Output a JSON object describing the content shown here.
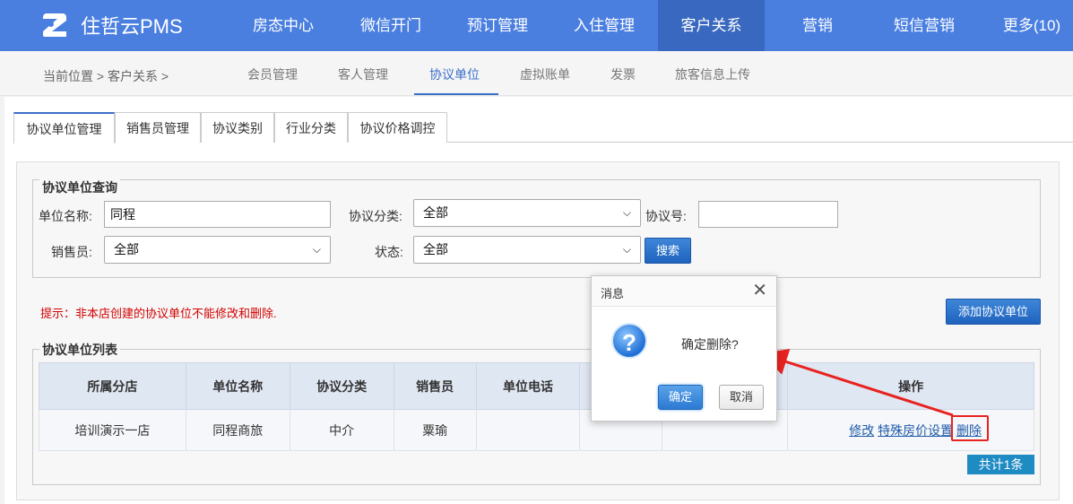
{
  "app": {
    "name": "住哲云PMS"
  },
  "nav": {
    "items": [
      {
        "label": "房态中心"
      },
      {
        "label": "微信开门"
      },
      {
        "label": "预订管理"
      },
      {
        "label": "入住管理"
      },
      {
        "label": "客户关系"
      },
      {
        "label": "营销"
      },
      {
        "label": "短信营销"
      },
      {
        "label": "更多(10)"
      }
    ]
  },
  "breadcrumb": "当前位置 > 客户关系 >",
  "subtabs": [
    {
      "label": "会员管理"
    },
    {
      "label": "客人管理"
    },
    {
      "label": "协议单位"
    },
    {
      "label": "虚拟账单"
    },
    {
      "label": "发票"
    },
    {
      "label": "旅客信息上传"
    }
  ],
  "tabs": [
    {
      "label": "协议单位管理"
    },
    {
      "label": "销售员管理"
    },
    {
      "label": "协议类别"
    },
    {
      "label": "行业分类"
    },
    {
      "label": "协议价格调控"
    }
  ],
  "query": {
    "legend": "协议单位查询",
    "name_label": "单位名称:",
    "name_value": "同程",
    "category_label": "协议分类:",
    "category_value": "全部",
    "code_label": "协议号:",
    "code_value": "",
    "sales_label": "销售员:",
    "sales_value": "全部",
    "status_label": "状态:",
    "status_value": "全部",
    "search_label": "搜索"
  },
  "tip": "提示：非本店创建的协议单位不能修改和删除.",
  "add_button": "添加协议单位",
  "list": {
    "legend": "协议单位列表",
    "headers": [
      "所属分店",
      "单位名称",
      "协议分类",
      "销售员",
      "单位电话",
      "",
      "",
      "操作"
    ],
    "rows": [
      {
        "branch": "培训演示一店",
        "name": "同程商旅",
        "category": "中介",
        "sales": "粟瑜",
        "phone": "",
        "c6": "",
        "c7": ""
      }
    ],
    "actions": {
      "edit": "修改",
      "special": "特殊房价设置",
      "delete": "删除"
    },
    "total": "共计1条"
  },
  "dialog": {
    "title": "消息",
    "message": "确定删除?",
    "ok": "确定",
    "cancel": "取消"
  },
  "colors": {
    "nav": "#4a7fe0",
    "accent": "#3a6fc9",
    "highlight": "#e8231f"
  },
  "icons": {
    "logo": "app-logo-icon",
    "question": "question-icon",
    "close": "close-icon"
  }
}
